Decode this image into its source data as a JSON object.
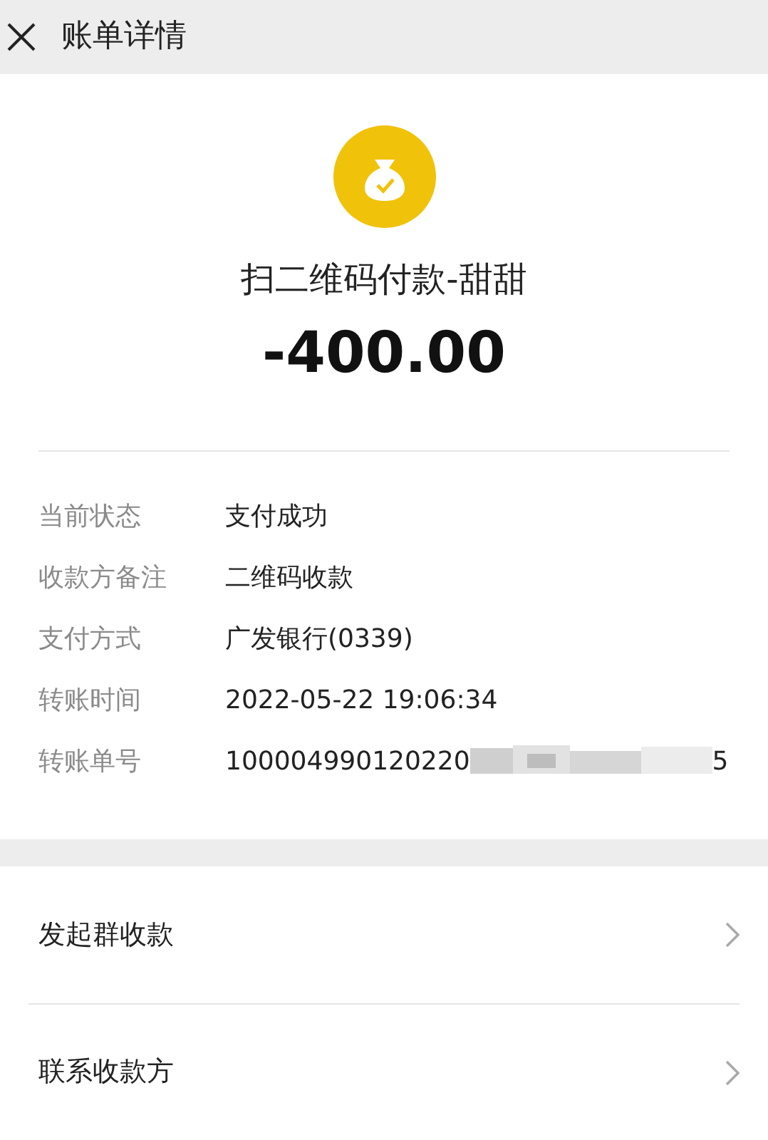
{
  "header": {
    "title": "账单详情"
  },
  "summary": {
    "title": "扫二维码付款-甜甜",
    "amount": "-400.00"
  },
  "details": [
    {
      "label": "当前状态",
      "value": "支付成功",
      "kind": "text"
    },
    {
      "label": "收款方备注",
      "value": "二维码收款",
      "kind": "text"
    },
    {
      "label": "支付方式",
      "value": "广发银行(0339)",
      "kind": "text"
    },
    {
      "label": "转账时间",
      "value": "2022-05-22 19:06:34",
      "kind": "text"
    },
    {
      "label": "转账单号",
      "value": "100004990120220",
      "value_end": "5",
      "kind": "masked"
    }
  ],
  "actions": [
    {
      "label": "发起群收款"
    },
    {
      "label": "联系收款方"
    }
  ]
}
